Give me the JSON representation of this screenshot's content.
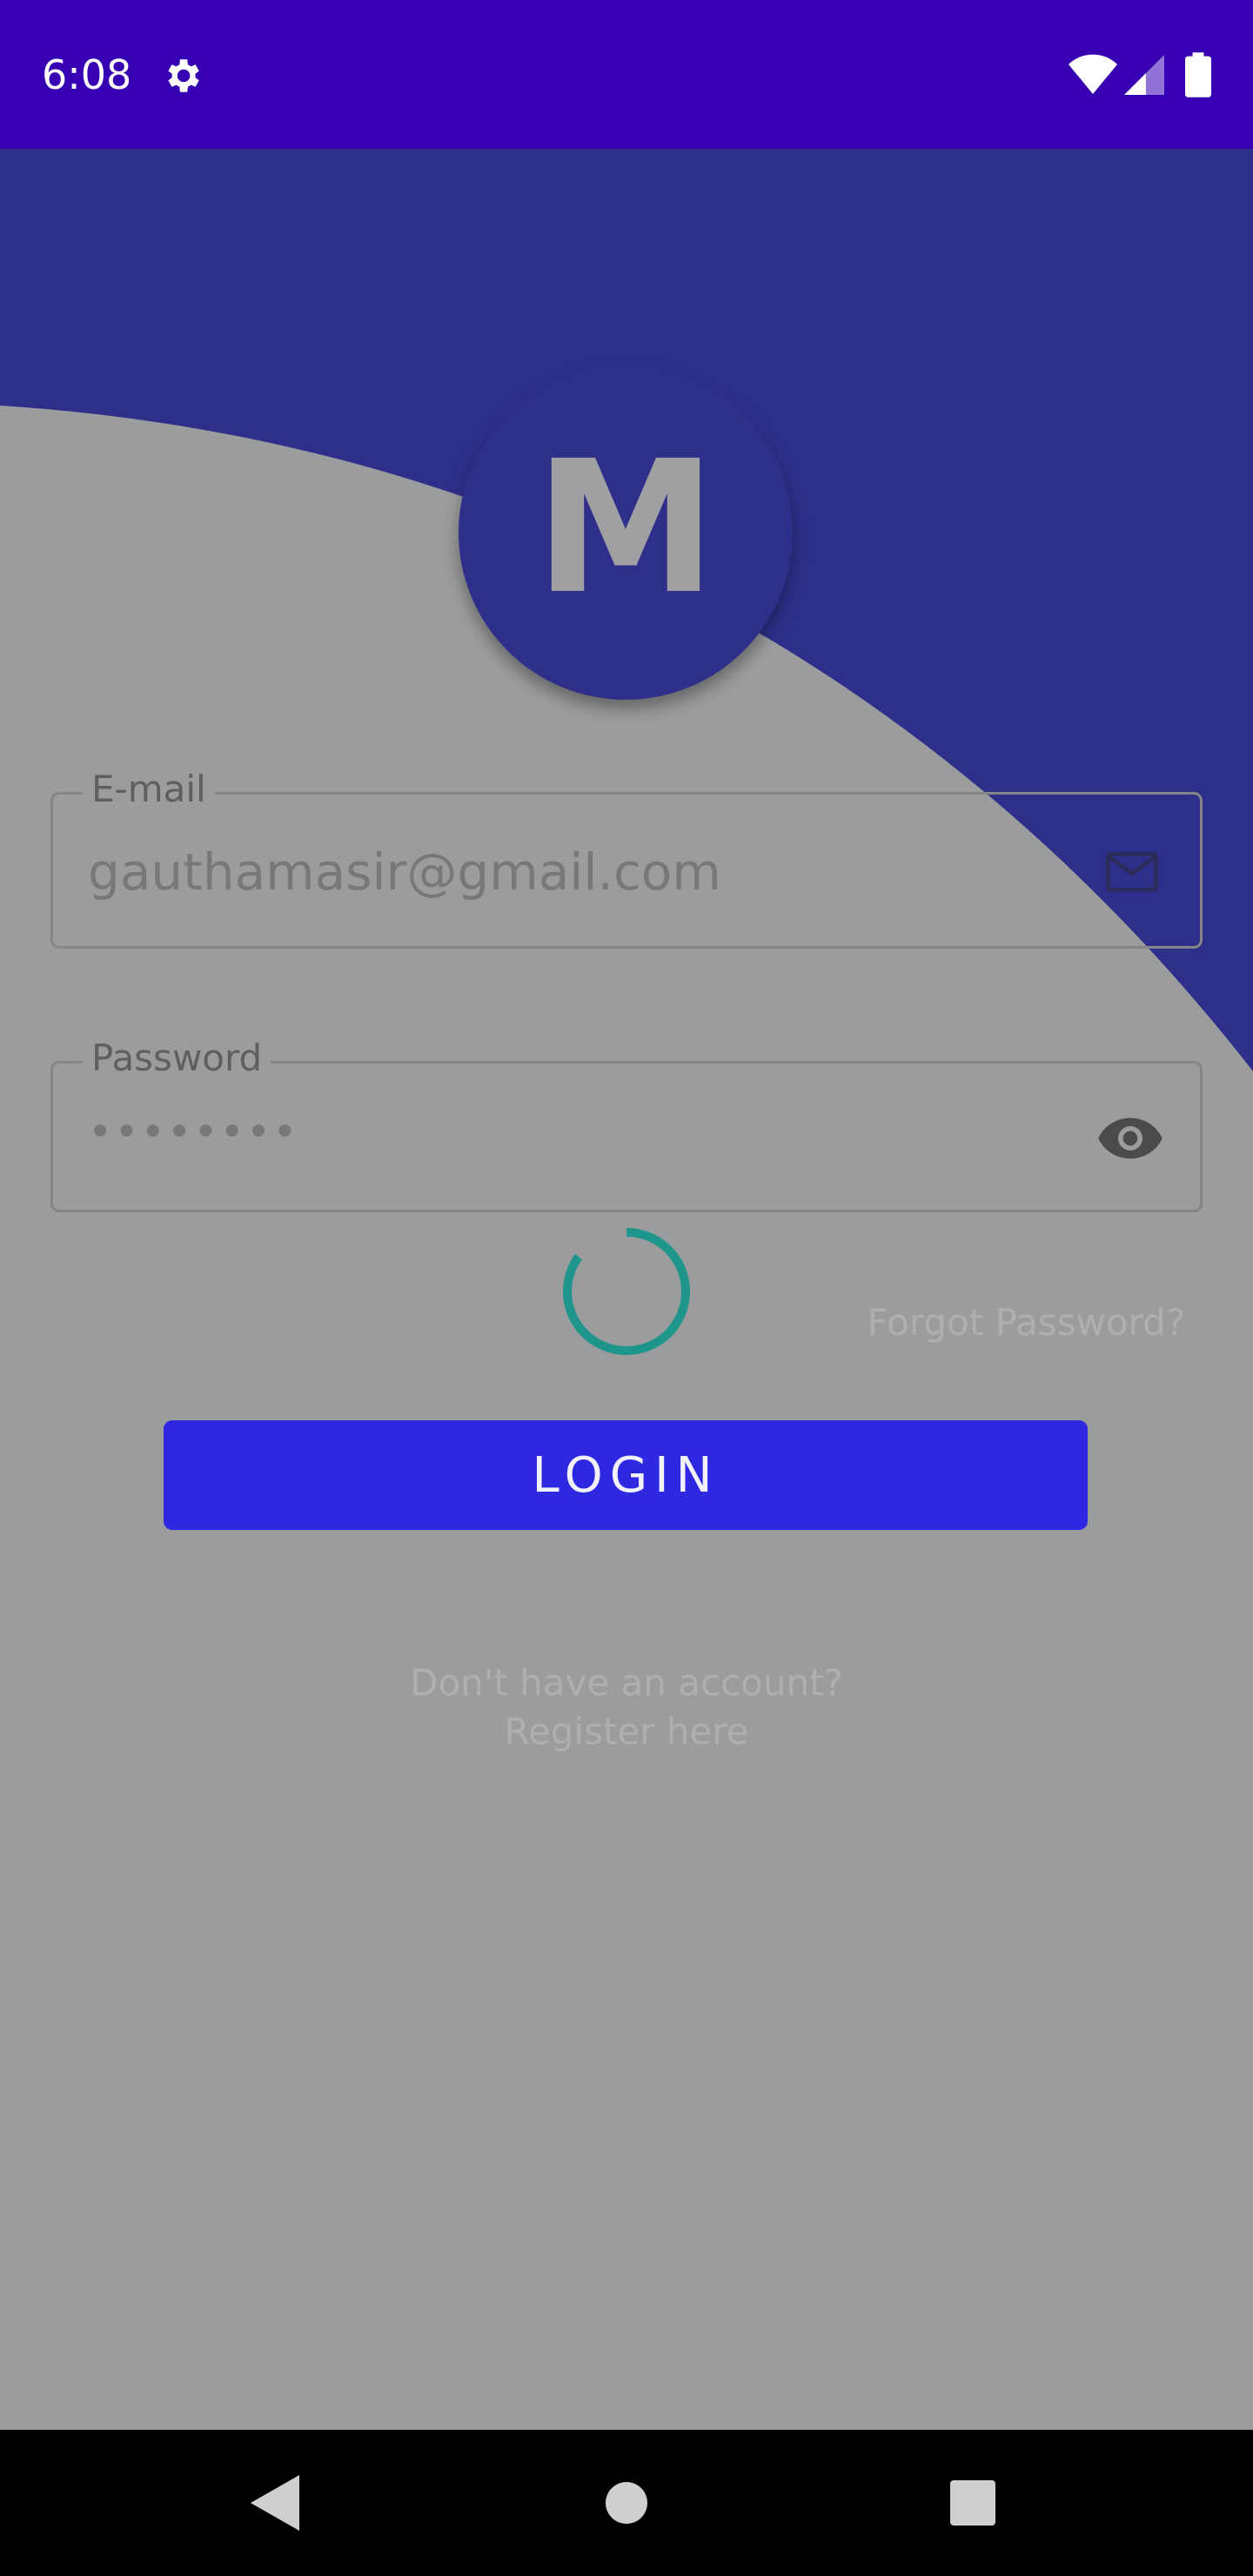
{
  "status_bar": {
    "time": "6:08",
    "background": "#3700b3",
    "icons": [
      "gear-icon",
      "wifi-icon",
      "signal-icon",
      "battery-icon"
    ]
  },
  "logo": {
    "letter": "M",
    "color": "#2e2f8a"
  },
  "email_field": {
    "label": "E-mail",
    "value": "gauthamasir@gmail.com",
    "icon": "mail-icon"
  },
  "password_field": {
    "label": "Password",
    "value": "••••••••",
    "icon": "eye-icon"
  },
  "loading": {
    "spinner_color": "#1f968b"
  },
  "forgot_password": "Forgot Password?",
  "login_button": {
    "label": "LOGIN",
    "color": "#2e28e0"
  },
  "register": {
    "line1": "Don't have an account?",
    "line2": "Register here"
  },
  "nav_bar": {
    "icons": [
      "back-icon",
      "home-icon",
      "recents-icon"
    ]
  }
}
